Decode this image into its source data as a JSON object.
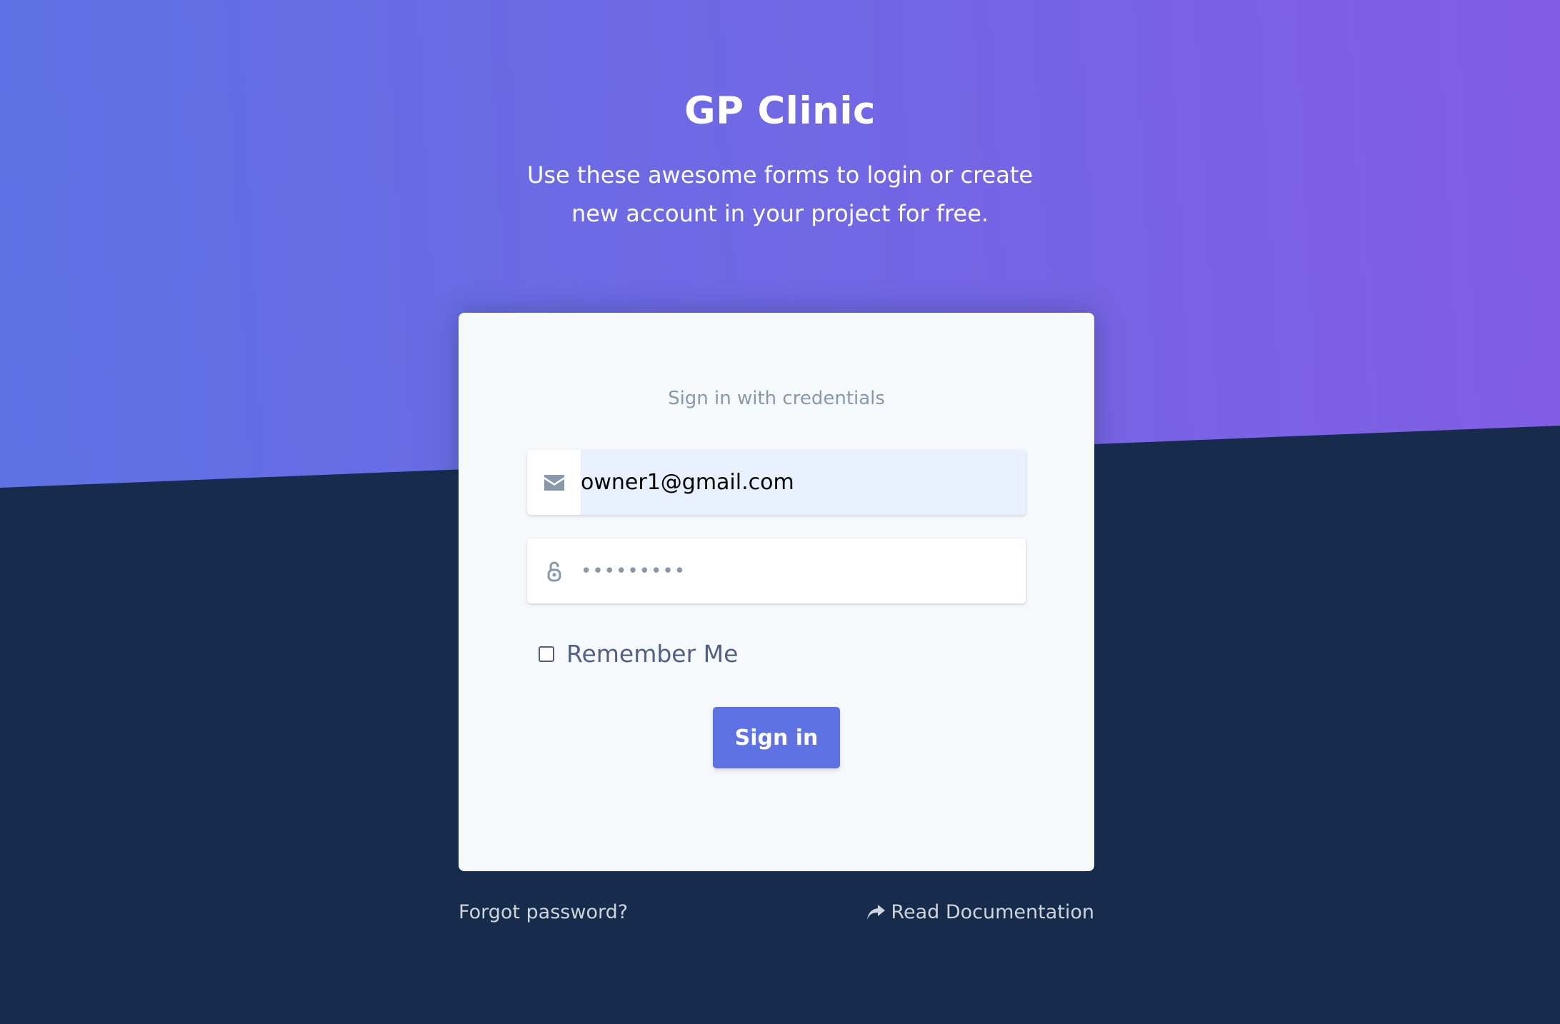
{
  "header": {
    "title": "GP Clinic",
    "subtitle": "Use these awesome forms to login or create new account in your project for free."
  },
  "login_card": {
    "caption": "Sign in with credentials",
    "email": {
      "icon": "envelope-icon",
      "value": "owner1@gmail.com"
    },
    "password": {
      "icon": "unlock-icon",
      "value": "•••••••••"
    },
    "remember_me": {
      "label": "Remember Me",
      "checked": false
    },
    "submit_label": "Sign in"
  },
  "footer": {
    "forgot_password": "Forgot password?",
    "read_docs": "Read Documentation",
    "read_docs_icon": "share-icon"
  },
  "colors": {
    "gradient_start": "#5e72e4",
    "gradient_end": "#825ee4",
    "background_dark": "#172b4d",
    "primary_button": "#5e72e4",
    "autofill_background": "#e8f0fe"
  }
}
